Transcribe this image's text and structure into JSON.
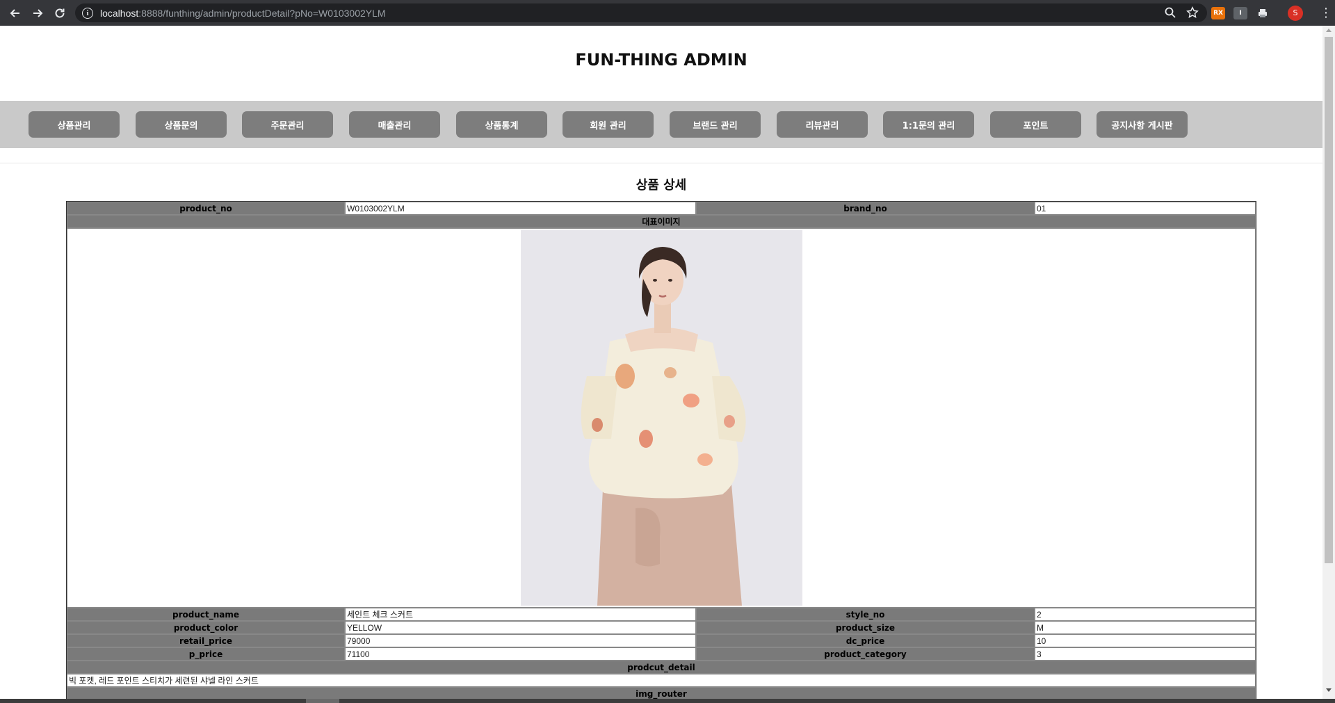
{
  "browser": {
    "url_host": "localhost",
    "url_rest": ":8888/funthing/admin/productDetail?pNo=W0103002YLM",
    "extensions": [
      {
        "label": "RX",
        "color": "#e8710a"
      },
      {
        "label": "I",
        "color": "#5f6368"
      },
      {
        "label": "",
        "color": "#5f6368"
      }
    ],
    "avatar_letter": "S"
  },
  "header": {
    "title": "FUN-THING ADMIN"
  },
  "menu": {
    "items": [
      "상품관리",
      "상품문의",
      "주문관리",
      "매출관리",
      "상품통계",
      "회원 관리",
      "브랜드 관리",
      "리뷰관리",
      "1:1문의 관리",
      "포인트",
      "공지사항 게시판"
    ]
  },
  "detail": {
    "title": "상품 상세",
    "product_no_label": "product_no",
    "product_no": "W0103002YLM",
    "brand_no_label": "brand_no",
    "brand_no": "01",
    "image_label": "대표이미지",
    "product_name_label": "product_name",
    "product_name": "세인트 체크 스커트",
    "style_no_label": "style_no",
    "style_no": "2",
    "product_color_label": "product_color",
    "product_color": "YELLOW",
    "product_size_label": "product_size",
    "product_size": "M",
    "retail_price_label": "retail_price",
    "retail_price": "79000",
    "dc_price_label": "dc_price",
    "dc_price": "10",
    "p_price_label": "p_price",
    "p_price": "71100",
    "product_category_label": "product_category",
    "product_category": "3",
    "detail_label": "prodcut_detail",
    "detail_text": "빅 포켓, 레드 포인트 스티치가 세련된 샤넬 라인 스커트",
    "img_router_label": "img_router"
  }
}
